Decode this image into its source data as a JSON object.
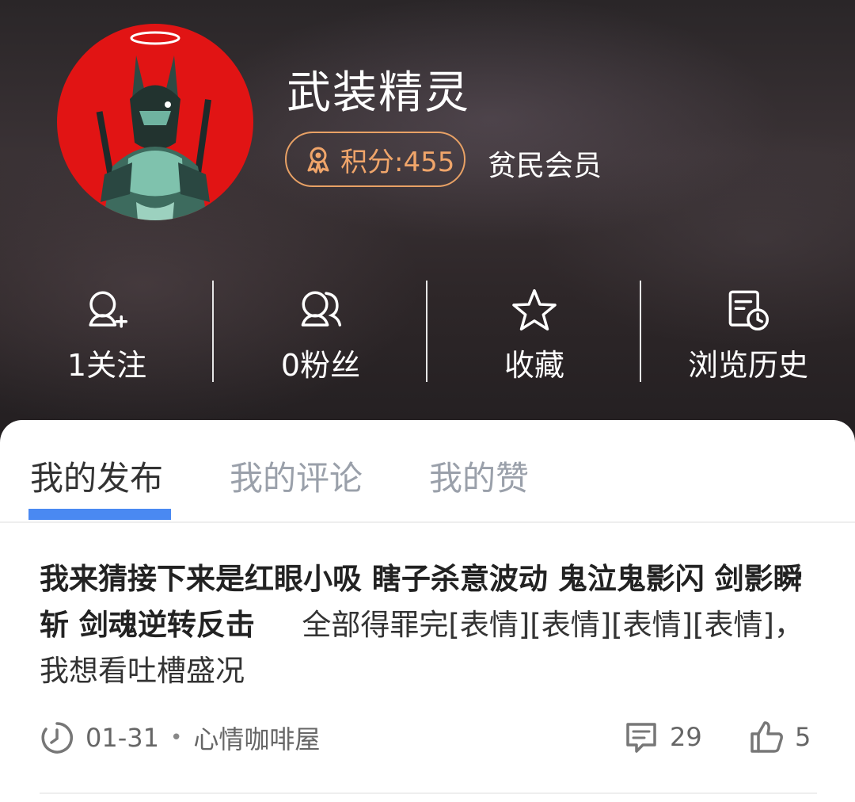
{
  "profile": {
    "username": "武装精灵",
    "points_label": "积分:455",
    "member_level": "贫民会员"
  },
  "stats": [
    {
      "label": "1关注",
      "icon": "user-plus-icon"
    },
    {
      "label": "0粉丝",
      "icon": "users-icon"
    },
    {
      "label": "收藏",
      "icon": "star-icon"
    },
    {
      "label": "浏览历史",
      "icon": "history-icon"
    }
  ],
  "tabs": [
    "我的发布",
    "我的评论",
    "我的赞"
  ],
  "post": {
    "title": "我来猜接下来是红眼小吸 瞎子杀意波动 鬼泣鬼影闪 剑影瞬斩 剑魂逆转反击",
    "body": "全部得罪完[表情][表情][表情][表情]，我想看吐槽盛况",
    "date": "01-31",
    "separator": "•",
    "forum": "心情咖啡屋",
    "comments": "29",
    "likes": "5"
  },
  "colors": {
    "points_accent": "#f0a56a",
    "tab_indicator": "#4a89f2",
    "avatar_bg": "#e11414"
  }
}
